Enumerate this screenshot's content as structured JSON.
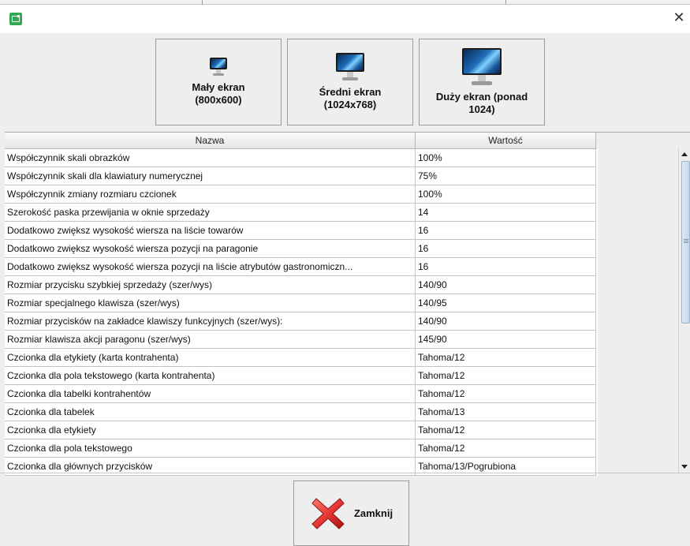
{
  "window": {
    "app_icon": "app-icon",
    "close_icon": "close-icon",
    "close_glyph": "✕"
  },
  "size_buttons": [
    {
      "label": "Mały ekran\n(800x600)",
      "icon": "small-monitor-icon"
    },
    {
      "label": "Średni ekran\n(1024x768)",
      "icon": "medium-monitor-icon"
    },
    {
      "label": "Duży ekran (ponad\n1024)",
      "icon": "large-monitor-icon"
    }
  ],
  "table": {
    "columns": [
      "Nazwa",
      "Wartość"
    ],
    "rows": [
      [
        "Współczynnik skali obrazków",
        "100%"
      ],
      [
        "Współczynnik skali dla klawiatury numerycznej",
        "75%"
      ],
      [
        "Współczynnik zmiany rozmiaru czcionek",
        "100%"
      ],
      [
        "Szerokość paska przewijania w oknie sprzedaży",
        "14"
      ],
      [
        "Dodatkowo zwiększ wysokość wiersza na liście towarów",
        "16"
      ],
      [
        "Dodatkowo zwiększ wysokość wiersza pozycji na paragonie",
        "16"
      ],
      [
        "Dodatkowo zwiększ wysokość wiersza pozycji na liście atrybutów gastronomiczn...",
        "16"
      ],
      [
        "Rozmiar przycisku szybkiej sprzedaży (szer/wys)",
        "140/90"
      ],
      [
        "Rozmiar specjalnego klawisza (szer/wys)",
        "140/95"
      ],
      [
        "Rozmiar przycisków na zakładce klawiszy funkcyjnych (szer/wys):",
        "140/90"
      ],
      [
        "Rozmiar klawisza akcji paragonu (szer/wys)",
        "145/90"
      ],
      [
        "Czcionka dla etykiety (karta kontrahenta)",
        "Tahoma/12"
      ],
      [
        "Czcionka dla pola tekstowego (karta kontrahenta)",
        "Tahoma/12"
      ],
      [
        "Czcionka dla tabelki kontrahentów",
        "Tahoma/12"
      ],
      [
        "Czcionka dla tabelek",
        "Tahoma/13"
      ],
      [
        "Czcionka dla etykiety",
        "Tahoma/12"
      ],
      [
        "Czcionka dla pola tekstowego",
        "Tahoma/12"
      ],
      [
        "Czcionka dla głównych przycisków",
        "Tahoma/13/Pogrubiona"
      ]
    ]
  },
  "footer": {
    "close_label": "Zamknij",
    "close_icon": "red-x-icon"
  },
  "colors": {
    "close_icon": "#e53935",
    "app_icon": "#33a853"
  }
}
